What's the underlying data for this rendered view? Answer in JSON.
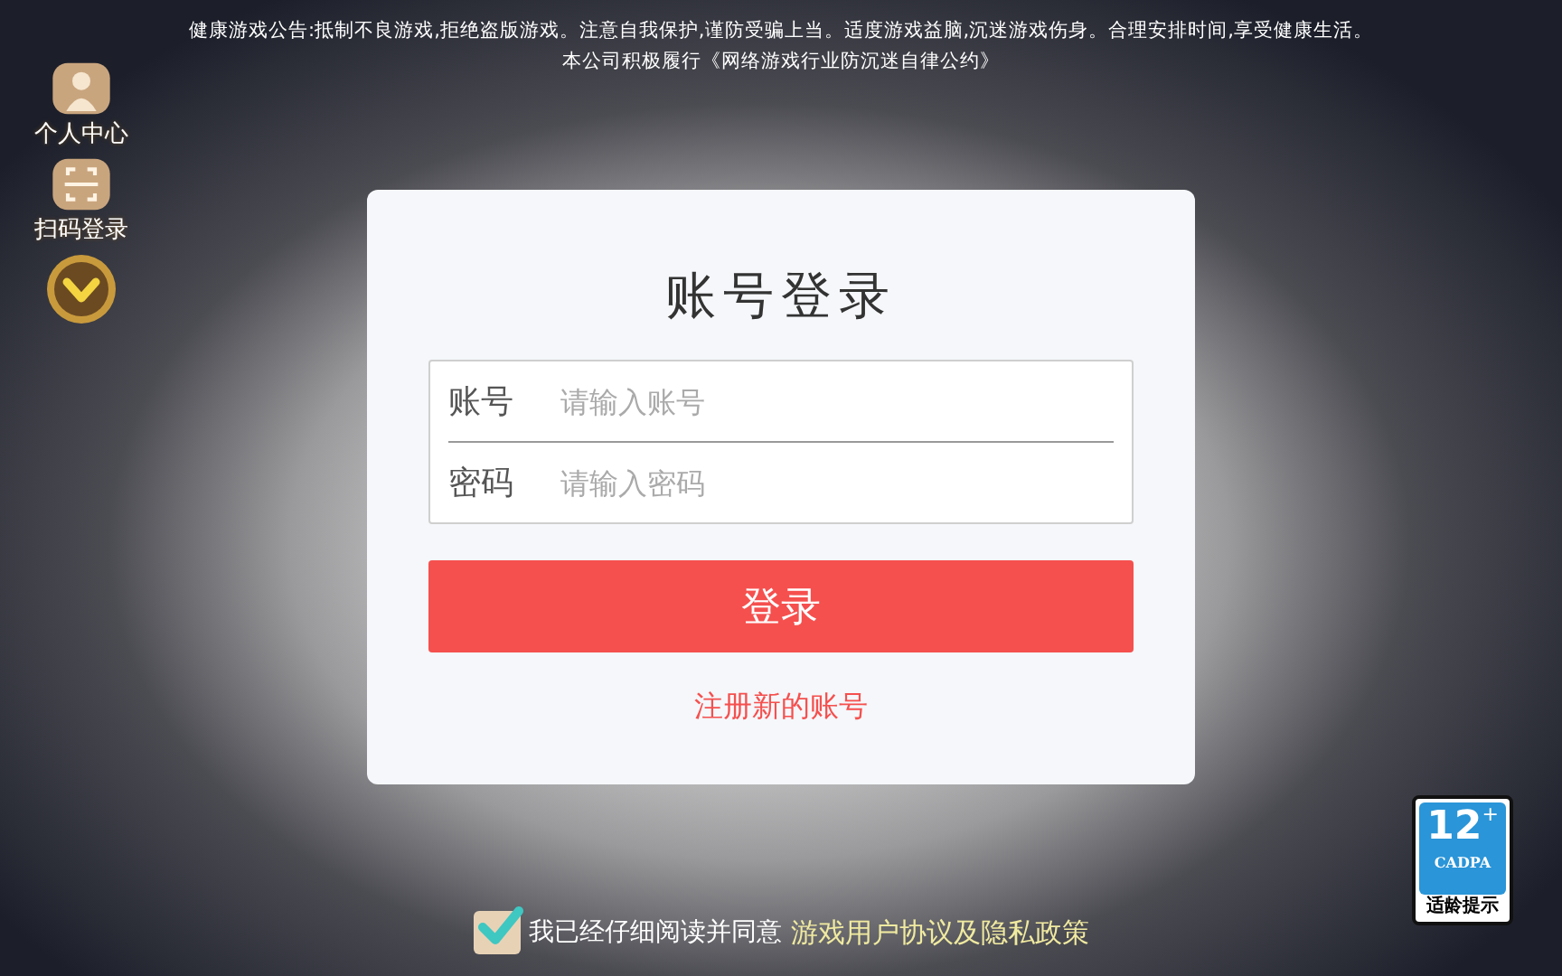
{
  "notice": {
    "lines": [
      "健康游戏公告:抵制不良游戏,拒绝盗版游戏。注意自我保护,谨防受骗上当。适度游戏益脑,沉迷游戏伤身。合理安排时间,享受健康生活。",
      "本公司积极履行《网络游戏行业防沉迷自律公约》"
    ]
  },
  "side_menu": [
    {
      "kind": "profile",
      "label": "个人中心"
    },
    {
      "kind": "scan",
      "label": "扫码登录"
    },
    {
      "kind": "more"
    }
  ],
  "login": {
    "title": "账号登录",
    "fields": [
      {
        "label": "账号",
        "placeholder": "请输入账号"
      },
      {
        "label": "密码",
        "placeholder": "请输入密码"
      }
    ],
    "submit": "登录",
    "register_link": "注册新的账号"
  },
  "age_badge": {
    "rating": "12",
    "plus": "+",
    "org": "CADPA",
    "caption": "适龄提示"
  },
  "agreement": {
    "checked": true,
    "text": "我已经仔细阅读并同意",
    "link": "游戏用户协议及隐私政策"
  }
}
